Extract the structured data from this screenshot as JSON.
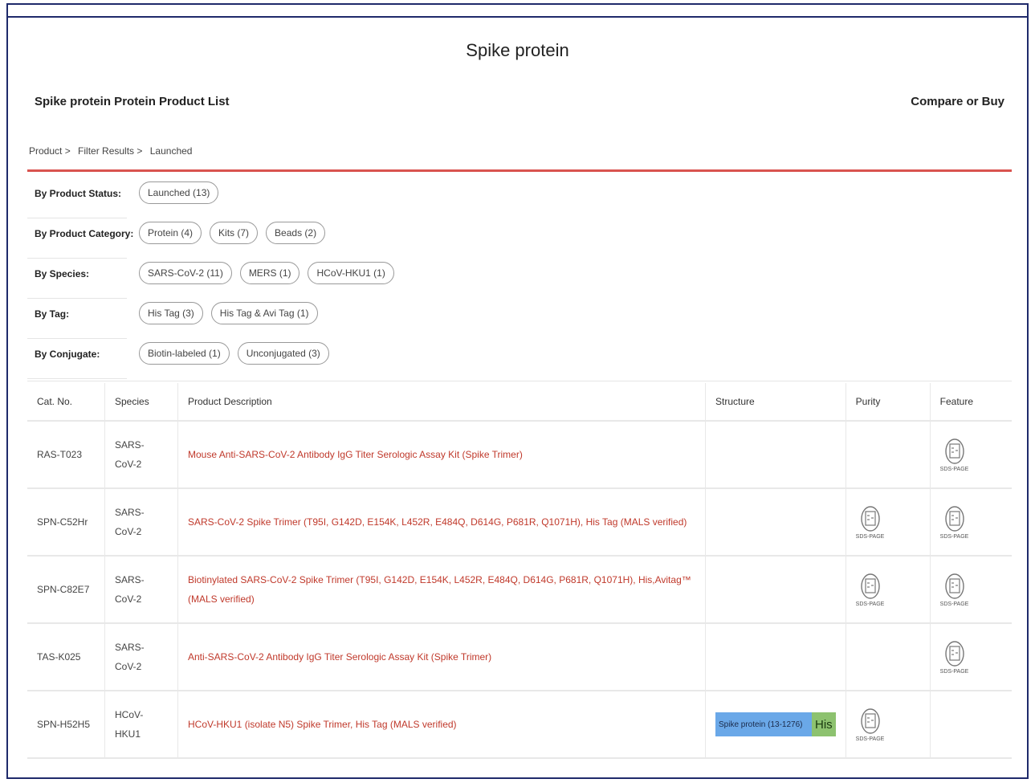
{
  "page": {
    "title": "Spike protein"
  },
  "header": {
    "list_title": "Spike protein Protein Product List",
    "compare_label": "Compare or Buy"
  },
  "breadcrumb": {
    "items": [
      "Product >",
      "Filter Results >",
      "Launched"
    ]
  },
  "filters": [
    {
      "label": "By Product Status:",
      "options": [
        "Launched (13)"
      ]
    },
    {
      "label": "By Product Category:",
      "options": [
        "Protein (4)",
        "Kits (7)",
        "Beads (2)"
      ]
    },
    {
      "label": "By Species:",
      "options": [
        "SARS-CoV-2 (11)",
        "MERS (1)",
        "HCoV-HKU1 (1)"
      ]
    },
    {
      "label": "By Tag:",
      "options": [
        "His Tag (3)",
        "His Tag & Avi Tag (1)"
      ]
    },
    {
      "label": "By Conjugate:",
      "options": [
        "Biotin-labeled (1)",
        "Unconjugated (3)"
      ]
    }
  ],
  "table": {
    "headers": [
      "Cat. No.",
      "Species",
      "Product Description",
      "Structure",
      "Purity",
      "Feature"
    ],
    "gel_caption": "SDS-PAGE",
    "structure": {
      "segment1": "Spike protein (13-1276)",
      "segment2": "His"
    },
    "rows": [
      {
        "cat": "RAS-T023",
        "species": [
          "SARS-",
          "CoV-2"
        ],
        "description": [
          "Mouse Anti-SARS-CoV-2 Antibody IgG Titer Serologic Assay Kit (Spike Trimer)"
        ],
        "structure": false,
        "purity": false,
        "feature": true
      },
      {
        "cat": "SPN-C52Hr",
        "species": [
          "SARS-",
          "CoV-2"
        ],
        "description": [
          "SARS-CoV-2 Spike Trimer (T95I, G142D, E154K, L452R, E484Q, D614G, P681R, Q1071H), His Tag (MALS verified)"
        ],
        "structure": false,
        "purity": true,
        "feature": true
      },
      {
        "cat": "SPN-C82E7",
        "species": [
          "SARS-",
          "CoV-2"
        ],
        "description": [
          "Biotinylated SARS-CoV-2 Spike Trimer (T95I, G142D, E154K, L452R, E484Q, D614G, P681R, Q1071H), His,Avitag™",
          "(MALS verified)"
        ],
        "structure": false,
        "purity": true,
        "feature": true
      },
      {
        "cat": "TAS-K025",
        "species": [
          "SARS-",
          "CoV-2"
        ],
        "description": [
          "Anti-SARS-CoV-2 Antibody IgG Titer Serologic Assay Kit (Spike Trimer)"
        ],
        "structure": false,
        "purity": false,
        "feature": true
      },
      {
        "cat": "SPN-H52H5",
        "species": [
          "HCoV-",
          "HKU1"
        ],
        "description": [
          "HCoV-HKU1 (isolate N5) Spike Trimer, His Tag (MALS verified)"
        ],
        "structure": true,
        "purity": true,
        "feature": false
      }
    ]
  }
}
